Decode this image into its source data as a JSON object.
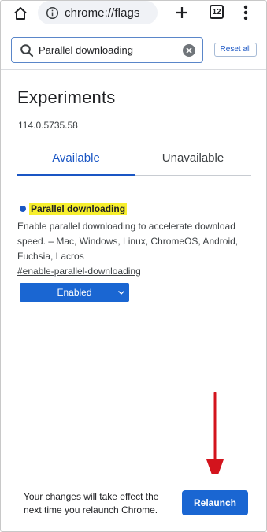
{
  "browser": {
    "url": "chrome://flags",
    "tab_count": "12"
  },
  "search": {
    "value": "Parallel downloading",
    "reset_label": "Reset all"
  },
  "main": {
    "title": "Experiments",
    "version": "114.0.5735.58",
    "tabs": [
      {
        "label": "Available",
        "selected": true
      },
      {
        "label": "Unavailable",
        "selected": false
      }
    ]
  },
  "flag": {
    "name": "Parallel downloading",
    "description": "Enable parallel downloading to accelerate download speed. – Mac, Windows, Linux, ChromeOS, Android, Fuchsia, Lacros",
    "link": "#enable-parallel-downloading",
    "selected_value": "Enabled"
  },
  "relaunch": {
    "message": "Your changes will take effect the next time you relaunch Chrome.",
    "button_label": "Relaunch"
  },
  "colors": {
    "accent": "#1a66d2",
    "highlight": "#f7ef2e",
    "annotation_arrow": "#d3141d"
  }
}
